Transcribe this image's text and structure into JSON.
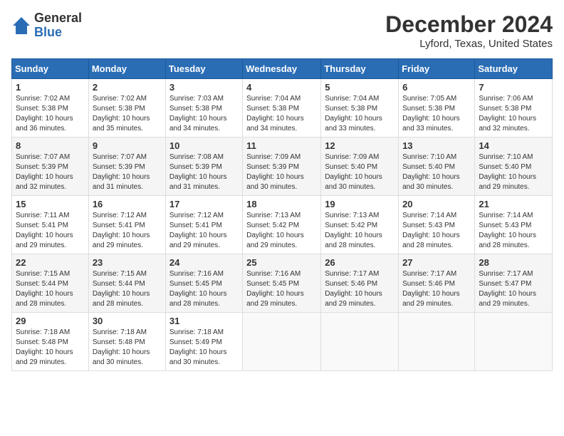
{
  "logo": {
    "general": "General",
    "blue": "Blue"
  },
  "title": "December 2024",
  "location": "Lyford, Texas, United States",
  "days_of_week": [
    "Sunday",
    "Monday",
    "Tuesday",
    "Wednesday",
    "Thursday",
    "Friday",
    "Saturday"
  ],
  "weeks": [
    [
      {
        "day": "1",
        "sunrise": "7:02 AM",
        "sunset": "5:38 PM",
        "daylight": "10 hours and 36 minutes."
      },
      {
        "day": "2",
        "sunrise": "7:02 AM",
        "sunset": "5:38 PM",
        "daylight": "10 hours and 35 minutes."
      },
      {
        "day": "3",
        "sunrise": "7:03 AM",
        "sunset": "5:38 PM",
        "daylight": "10 hours and 34 minutes."
      },
      {
        "day": "4",
        "sunrise": "7:04 AM",
        "sunset": "5:38 PM",
        "daylight": "10 hours and 34 minutes."
      },
      {
        "day": "5",
        "sunrise": "7:04 AM",
        "sunset": "5:38 PM",
        "daylight": "10 hours and 33 minutes."
      },
      {
        "day": "6",
        "sunrise": "7:05 AM",
        "sunset": "5:38 PM",
        "daylight": "10 hours and 33 minutes."
      },
      {
        "day": "7",
        "sunrise": "7:06 AM",
        "sunset": "5:38 PM",
        "daylight": "10 hours and 32 minutes."
      }
    ],
    [
      {
        "day": "8",
        "sunrise": "7:07 AM",
        "sunset": "5:39 PM",
        "daylight": "10 hours and 32 minutes."
      },
      {
        "day": "9",
        "sunrise": "7:07 AM",
        "sunset": "5:39 PM",
        "daylight": "10 hours and 31 minutes."
      },
      {
        "day": "10",
        "sunrise": "7:08 AM",
        "sunset": "5:39 PM",
        "daylight": "10 hours and 31 minutes."
      },
      {
        "day": "11",
        "sunrise": "7:09 AM",
        "sunset": "5:39 PM",
        "daylight": "10 hours and 30 minutes."
      },
      {
        "day": "12",
        "sunrise": "7:09 AM",
        "sunset": "5:40 PM",
        "daylight": "10 hours and 30 minutes."
      },
      {
        "day": "13",
        "sunrise": "7:10 AM",
        "sunset": "5:40 PM",
        "daylight": "10 hours and 30 minutes."
      },
      {
        "day": "14",
        "sunrise": "7:10 AM",
        "sunset": "5:40 PM",
        "daylight": "10 hours and 29 minutes."
      }
    ],
    [
      {
        "day": "15",
        "sunrise": "7:11 AM",
        "sunset": "5:41 PM",
        "daylight": "10 hours and 29 minutes."
      },
      {
        "day": "16",
        "sunrise": "7:12 AM",
        "sunset": "5:41 PM",
        "daylight": "10 hours and 29 minutes."
      },
      {
        "day": "17",
        "sunrise": "7:12 AM",
        "sunset": "5:41 PM",
        "daylight": "10 hours and 29 minutes."
      },
      {
        "day": "18",
        "sunrise": "7:13 AM",
        "sunset": "5:42 PM",
        "daylight": "10 hours and 29 minutes."
      },
      {
        "day": "19",
        "sunrise": "7:13 AM",
        "sunset": "5:42 PM",
        "daylight": "10 hours and 28 minutes."
      },
      {
        "day": "20",
        "sunrise": "7:14 AM",
        "sunset": "5:43 PM",
        "daylight": "10 hours and 28 minutes."
      },
      {
        "day": "21",
        "sunrise": "7:14 AM",
        "sunset": "5:43 PM",
        "daylight": "10 hours and 28 minutes."
      }
    ],
    [
      {
        "day": "22",
        "sunrise": "7:15 AM",
        "sunset": "5:44 PM",
        "daylight": "10 hours and 28 minutes."
      },
      {
        "day": "23",
        "sunrise": "7:15 AM",
        "sunset": "5:44 PM",
        "daylight": "10 hours and 28 minutes."
      },
      {
        "day": "24",
        "sunrise": "7:16 AM",
        "sunset": "5:45 PM",
        "daylight": "10 hours and 28 minutes."
      },
      {
        "day": "25",
        "sunrise": "7:16 AM",
        "sunset": "5:45 PM",
        "daylight": "10 hours and 29 minutes."
      },
      {
        "day": "26",
        "sunrise": "7:17 AM",
        "sunset": "5:46 PM",
        "daylight": "10 hours and 29 minutes."
      },
      {
        "day": "27",
        "sunrise": "7:17 AM",
        "sunset": "5:46 PM",
        "daylight": "10 hours and 29 minutes."
      },
      {
        "day": "28",
        "sunrise": "7:17 AM",
        "sunset": "5:47 PM",
        "daylight": "10 hours and 29 minutes."
      }
    ],
    [
      {
        "day": "29",
        "sunrise": "7:18 AM",
        "sunset": "5:48 PM",
        "daylight": "10 hours and 29 minutes."
      },
      {
        "day": "30",
        "sunrise": "7:18 AM",
        "sunset": "5:48 PM",
        "daylight": "10 hours and 30 minutes."
      },
      {
        "day": "31",
        "sunrise": "7:18 AM",
        "sunset": "5:49 PM",
        "daylight": "10 hours and 30 minutes."
      },
      null,
      null,
      null,
      null
    ]
  ],
  "labels": {
    "sunrise": "Sunrise:",
    "sunset": "Sunset:",
    "daylight": "Daylight:"
  }
}
